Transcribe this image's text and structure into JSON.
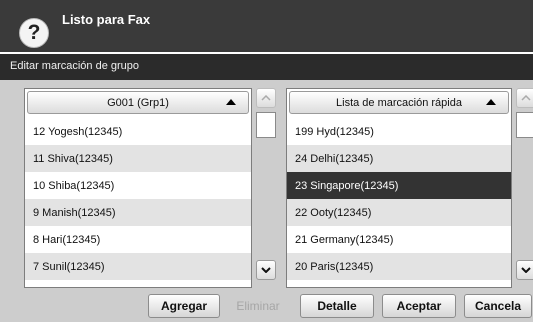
{
  "header": {
    "status": "Listo para Fax",
    "help_icon": "question-mark-icon"
  },
  "subheader": {
    "title": "Editar marcación de grupo"
  },
  "group_list": {
    "title": "G001 (Grp1)",
    "rows": [
      "12  Yogesh(12345)",
      "11  Shiva(12345)",
      "10  Shiba(12345)",
      "9  Manish(12345)",
      "8  Hari(12345)",
      "7  Sunil(12345)"
    ]
  },
  "speed_list": {
    "title": "Lista de marcación rápida",
    "selected_index": 2,
    "rows": [
      "199  Hyd(12345)",
      "24  Delhi(12345)",
      "23  Singapore(12345)",
      "22  Ooty(12345)",
      "21  Germany(12345)",
      "20  Paris(12345)"
    ]
  },
  "buttons": {
    "add": "Agregar",
    "delete": "Eliminar",
    "detail": "Detalle",
    "accept": "Aceptar",
    "cancel": "Cancela"
  },
  "colors": {
    "title_bar": "#3a3a3a",
    "sub_bar": "#2b2b2b",
    "panel": "#cdcdcd",
    "selected_row": "#333333"
  }
}
